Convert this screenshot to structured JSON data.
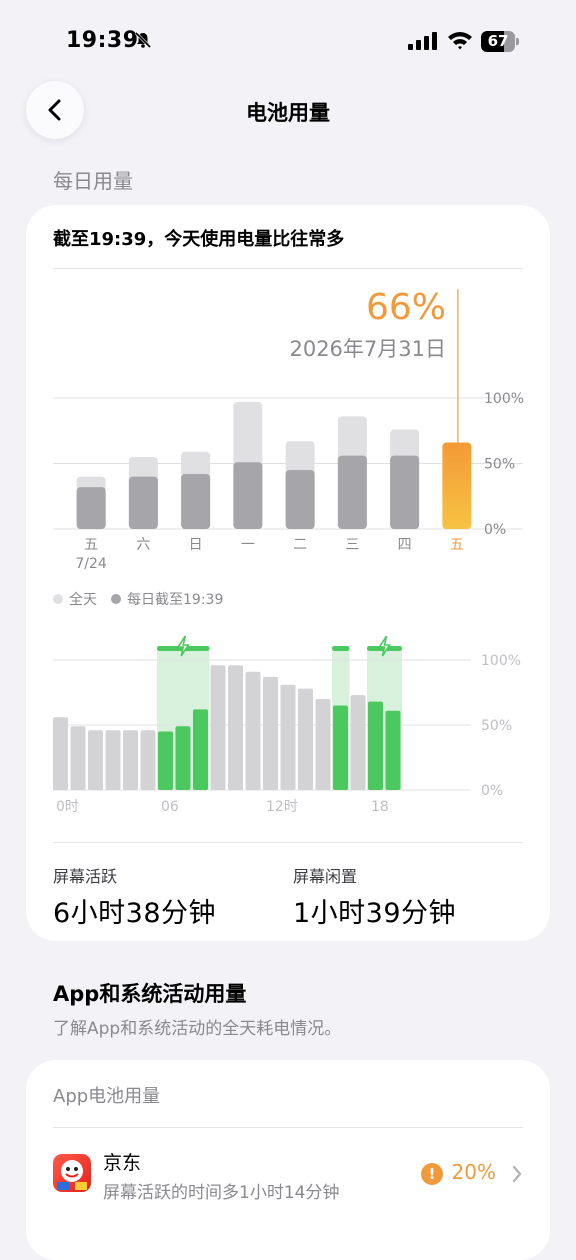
{
  "status": {
    "time": "19:39",
    "battery": "67",
    "battery_level": 0.67,
    "icons": [
      "bell-slash-icon",
      "cellular-signal-icon",
      "wifi-icon",
      "battery-icon"
    ]
  },
  "nav": {
    "title": "电池用量",
    "back_icon": "chevron-left-icon"
  },
  "section_daily": "每日用量",
  "card": {
    "headline": "截至19:39，今天使用电量比往常多",
    "highlight": {
      "percent": "66%",
      "date": "2026年7月31日"
    },
    "legend": [
      {
        "label": "全天",
        "color": "#e0e0e3"
      },
      {
        "label": "每日截至19:39",
        "color": "#a6a6aa"
      }
    ],
    "stats": [
      {
        "label": "屏幕活跃",
        "value": "6小时38分钟"
      },
      {
        "label": "屏幕闲置",
        "value": "1小时39分钟"
      }
    ]
  },
  "chart_data": [
    {
      "type": "bar",
      "categories": [
        "五",
        "六",
        "日",
        "一",
        "二",
        "三",
        "四",
        "五"
      ],
      "category_sublabels": [
        "7/24",
        "",
        "",
        "",
        "",
        "",
        "",
        ""
      ],
      "series": [
        {
          "name": "全天",
          "values": [
            40,
            55,
            59,
            97,
            67,
            86,
            76,
            66
          ],
          "color": "#e0e0e3"
        },
        {
          "name": "每日截至19:39",
          "values": [
            32,
            40,
            42,
            51,
            45,
            56,
            56,
            66
          ],
          "color": "#a6a6aa"
        }
      ],
      "highlight_index": 7,
      "highlight_color": "#f5a133",
      "y_ticks": [
        "0%",
        "50%",
        "100%"
      ],
      "ylim": [
        0,
        100
      ]
    },
    {
      "type": "bar",
      "x_ticks": [
        "0时",
        "06",
        "12时",
        "18"
      ],
      "values": [
        56,
        49,
        46,
        46,
        46,
        46,
        45,
        49,
        62,
        96,
        96,
        91,
        87,
        81,
        78,
        70,
        65,
        73,
        68,
        61
      ],
      "charging": [
        false,
        false,
        false,
        false,
        false,
        false,
        true,
        true,
        true,
        false,
        false,
        false,
        false,
        false,
        false,
        false,
        true,
        false,
        true,
        true
      ],
      "charging_segments": [
        [
          6,
          8
        ],
        [
          16,
          16
        ],
        [
          18,
          19
        ]
      ],
      "bar_color": "#d3d3d6",
      "charging_color": "#4cc95e",
      "y_ticks": [
        "0%",
        "50%",
        "100%"
      ],
      "ylim": [
        0,
        100
      ]
    }
  ],
  "section_apps": {
    "title": "App和系统活动用量",
    "subtitle": "了解App和系统活动的全天耗电情况。"
  },
  "app_card": {
    "title": "App电池用量",
    "apps": [
      {
        "name": "京东",
        "desc": "屏幕活跃的时间多1小时14分钟",
        "percent": "20%",
        "warn": "!",
        "icon": "jd-app-icon"
      }
    ]
  }
}
